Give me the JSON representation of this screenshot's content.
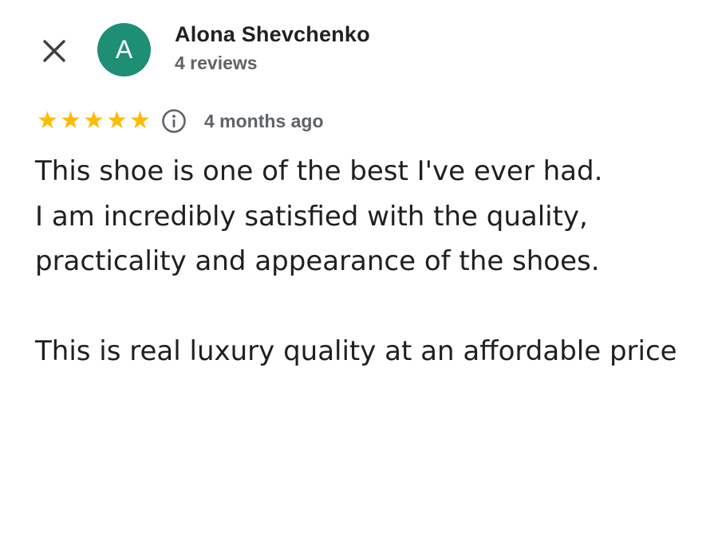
{
  "header": {
    "close_icon": "close-icon",
    "avatar_letter": "A",
    "avatar_color": "#1e8e74",
    "author_name": "Alona Shevchenko",
    "review_count": "4 reviews"
  },
  "rating": {
    "stars": 5,
    "max_stars": 5,
    "star_color": "#fbbc04",
    "info_icon": "info-icon",
    "time_ago": "4 months ago"
  },
  "review": {
    "paragraph_1_line_1": "This shoe is one of the best I've ever had.",
    "paragraph_1_line_2": "I am incredibly satisfied with the quality, practicality and appearance of the shoes.",
    "paragraph_2": "This is real luxury quality at an affordable price"
  }
}
